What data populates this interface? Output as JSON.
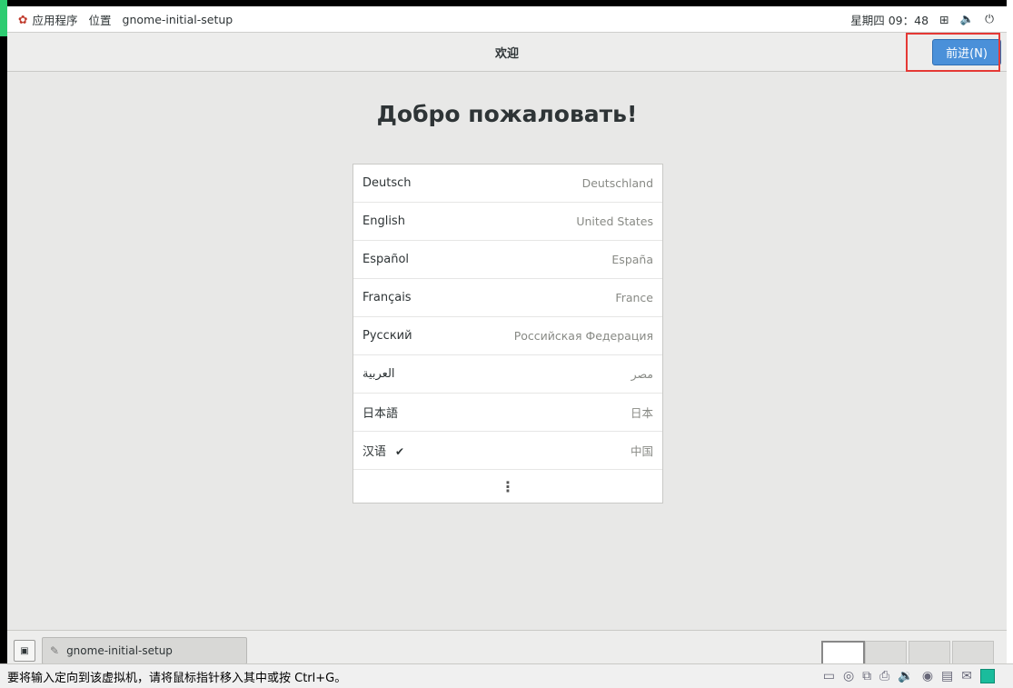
{
  "topbar": {
    "apps_label": "应用程序",
    "places_label": "位置",
    "app_name": "gnome-initial-setup",
    "clock": "星期四 09：48"
  },
  "header": {
    "title": "欢迎",
    "next_label": "前进(N)"
  },
  "welcome_title": "Добро пожаловать!",
  "languages": [
    {
      "name": "Deutsch",
      "region": "Deutschland"
    },
    {
      "name": "English",
      "region": "United States"
    },
    {
      "name": "Español",
      "region": "España"
    },
    {
      "name": "Français",
      "region": "France"
    },
    {
      "name": "Русский",
      "region": "Российская Федерация"
    },
    {
      "name": "العربية",
      "region": "مصر"
    },
    {
      "name": "日本語",
      "region": "日本"
    },
    {
      "name": "汉语",
      "region": "中国",
      "selected": true
    }
  ],
  "more_label": "⋮",
  "taskbar": {
    "task_label": "gnome-initial-setup"
  },
  "statusbar": {
    "message": "要将输入定向到该虚拟机，请将鼠标指针移入其中或按 Ctrl+G。"
  },
  "colors": {
    "accent": "#4a90d9",
    "focus_frame": "#e53935"
  }
}
